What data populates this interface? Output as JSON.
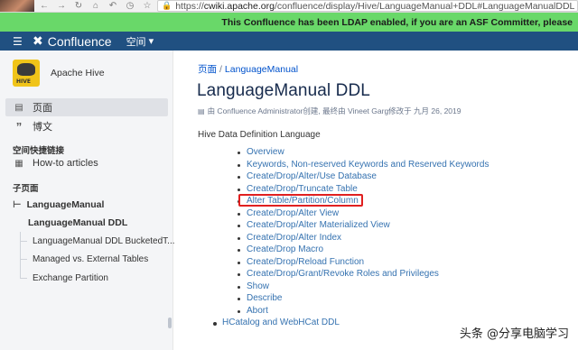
{
  "browser": {
    "url_prefix": "https://",
    "url_host": "cwiki.apache.org",
    "url_path": "/confluence/display/Hive/LanguageManual+DDL#LanguageManualDDL"
  },
  "banner": {
    "text": "This Confluence has been LDAP enabled, if you are an ASF Committer, please"
  },
  "topnav": {
    "app_name": "Confluence",
    "space_menu": "空间",
    "colors": {
      "header_bg": "#205081",
      "banner_bg": "#69d869"
    }
  },
  "sidebar": {
    "space_name": "Apache Hive",
    "nav": [
      {
        "label": "页面",
        "icon": "page-icon"
      },
      {
        "label": "博文",
        "icon": "quote-icon"
      }
    ],
    "shortcuts_heading": "空间快捷链接",
    "shortcuts": [
      {
        "label": "How-to articles",
        "icon": "notebook-icon"
      }
    ],
    "children_heading": "子页面",
    "tree": [
      {
        "label": "LanguageManual"
      },
      {
        "label": "LanguageManual DDL"
      },
      {
        "label": "LanguageManual DDL BucketedT..."
      },
      {
        "label": "Managed vs. External Tables"
      },
      {
        "label": "Exchange Partition"
      }
    ]
  },
  "main": {
    "breadcrumb": [
      "页面",
      "LanguageManual"
    ],
    "breadcrumb_sep": "/",
    "title": "LanguageManual DDL",
    "byline": "由 Confluence Administrator创建, 最终由 Vineet Garg修改于 九月 26, 2019",
    "intro": "Hive Data Definition Language",
    "toc": [
      "Overview",
      "Keywords, Non-reserved Keywords and Reserved Keywords",
      "Create/Drop/Alter/Use Database",
      "Create/Drop/Truncate Table",
      "Alter Table/Partition/Column",
      "Create/Drop/Alter View",
      "Create/Drop/Alter Materialized View",
      "Create/Drop/Alter Index",
      "Create/Drop Macro",
      "Create/Drop/Reload Function",
      "Create/Drop/Grant/Revoke Roles and Privileges",
      "Show",
      "Describe",
      "Abort"
    ],
    "toc_top": "HCatalog and WebHCat DDL"
  },
  "watermark": "头条 @分享电脑学习"
}
